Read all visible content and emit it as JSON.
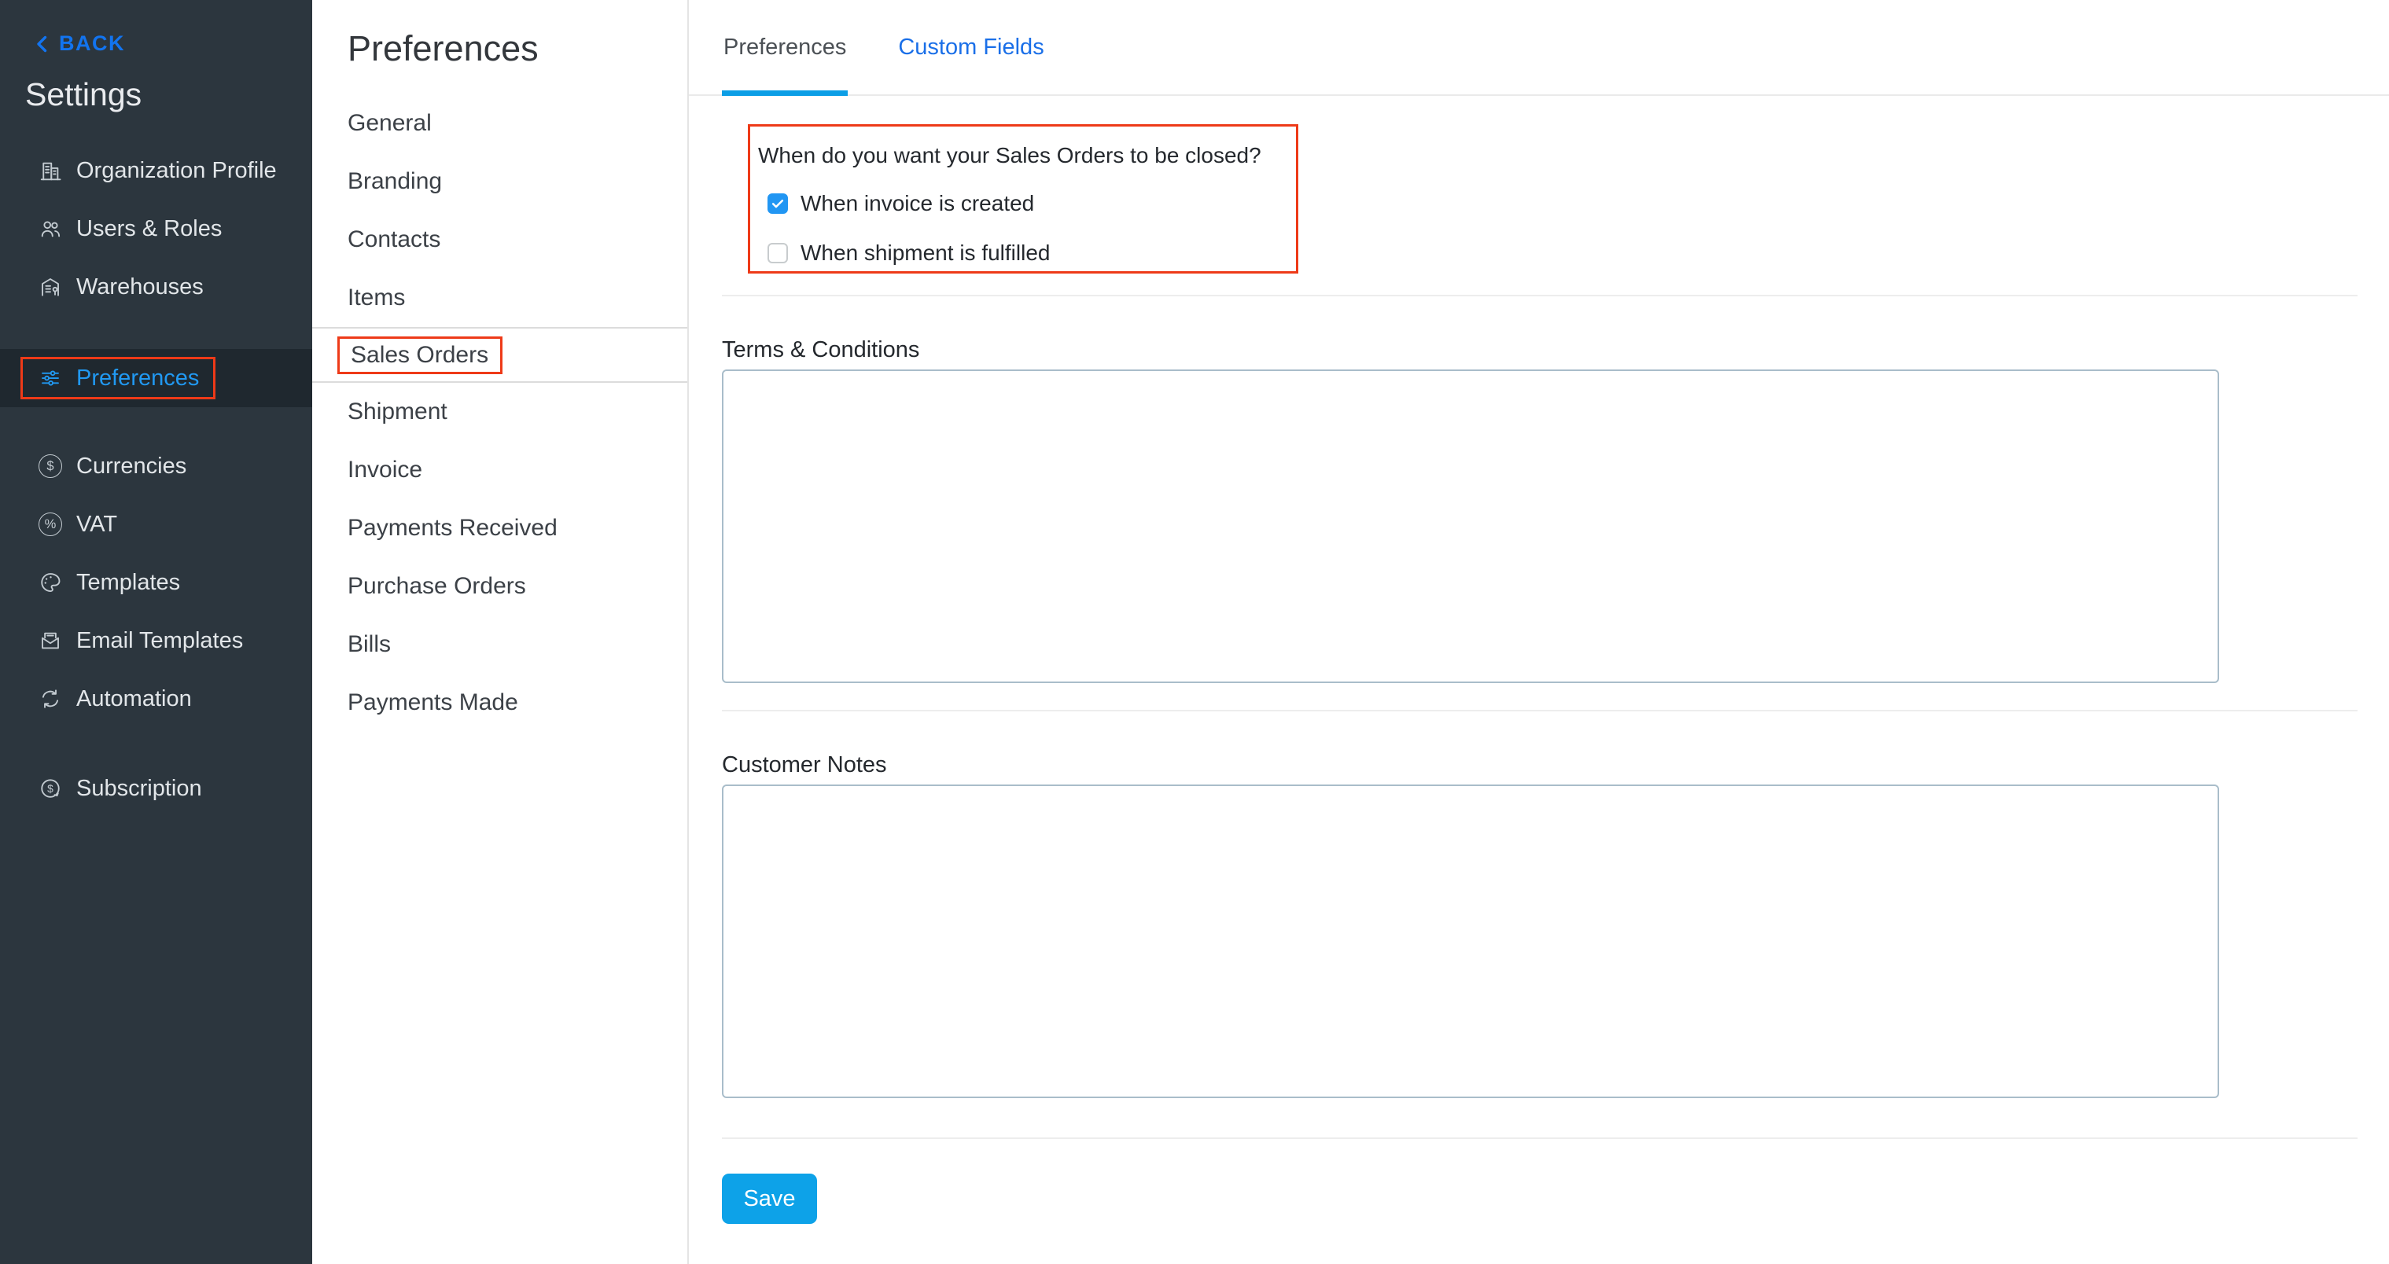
{
  "sidebar": {
    "back_label": "BACK",
    "title": "Settings",
    "items": [
      {
        "label": "Organization Profile",
        "icon": "building-icon",
        "selected": false
      },
      {
        "label": "Users & Roles",
        "icon": "users-icon",
        "selected": false
      },
      {
        "label": "Warehouses",
        "icon": "warehouse-icon",
        "selected": false
      },
      {
        "label": "Preferences",
        "icon": "sliders-icon",
        "selected": true,
        "annotated": true
      },
      {
        "label": "Currencies",
        "icon": "dollar-circle-icon",
        "selected": false
      },
      {
        "label": "VAT",
        "icon": "percent-circle-icon",
        "selected": false
      },
      {
        "label": "Templates",
        "icon": "palette-icon",
        "selected": false
      },
      {
        "label": "Email Templates",
        "icon": "envelope-icon",
        "selected": false
      },
      {
        "label": "Automation",
        "icon": "sync-icon",
        "selected": false
      },
      {
        "label": "Subscription",
        "icon": "dollar-refresh-icon",
        "selected": false
      }
    ]
  },
  "subnav": {
    "title": "Preferences",
    "items": [
      "General",
      "Branding",
      "Contacts",
      "Items",
      "Sales Orders",
      "Shipment",
      "Invoice",
      "Payments Received",
      "Purchase Orders",
      "Bills",
      "Payments Made"
    ],
    "selected_item": "Sales Orders"
  },
  "content": {
    "tabs": [
      {
        "label": "Preferences",
        "active": true
      },
      {
        "label": "Custom Fields",
        "active": false
      }
    ],
    "close_question": {
      "text": "When do you want your Sales Orders to be closed?",
      "options": [
        {
          "label": "When invoice is created",
          "checked": true
        },
        {
          "label": "When shipment is fulfilled",
          "checked": false
        }
      ]
    },
    "terms_label": "Terms & Conditions",
    "terms_value": "",
    "customer_notes_label": "Customer Notes",
    "customer_notes_value": "",
    "save_label": "Save"
  },
  "colors": {
    "sidebar_bg": "#2c363e",
    "sidebar_selected_bg": "#1f282f",
    "sidebar_active_blue": "#2199f2",
    "back_link_blue": "#1274f0",
    "tab_link_blue": "#1a6fe8",
    "tab_underline_cyan": "#0c9ee6",
    "checkbox_blue": "#2196f3",
    "save_button_blue": "#0da2e8",
    "annotation_red": "#ee3a18",
    "textarea_border": "#a9bdca"
  }
}
